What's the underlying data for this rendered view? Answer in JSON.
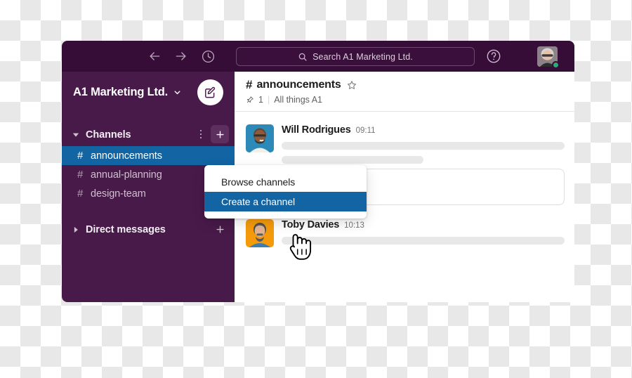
{
  "window": {
    "app": "Slack"
  },
  "topbar": {
    "back_icon": "arrow-left-icon",
    "forward_icon": "arrow-right-icon",
    "history_icon": "clock-icon",
    "search_icon": "search-icon",
    "search_placeholder": "Search A1 Marketing Ltd.",
    "search_value": "",
    "help_icon": "question-circle-icon",
    "avatar_name": "user-avatar",
    "presence": "online",
    "bg_color": "#350d36"
  },
  "sidebar": {
    "workspace_name": "A1 Marketing Ltd.",
    "workspace_caret_icon": "chevron-down-icon",
    "compose_icon": "compose-pencil-icon",
    "bg_color": "#481a49",
    "active_color": "#1264a3",
    "sections": [
      {
        "title": "Channels",
        "caret_icon": "caret-down-icon",
        "kebab_icon": "kebab-vertical-icon",
        "plus_icon": "plus-icon",
        "expanded": true,
        "channels": [
          {
            "hash": "#",
            "name": "announcements",
            "active": true
          },
          {
            "hash": "#",
            "name": "annual-planning",
            "active": false
          },
          {
            "hash": "#",
            "name": "design-team",
            "active": false
          }
        ]
      },
      {
        "title": "Direct messages",
        "caret_icon": "caret-right-icon",
        "plus_icon": "plus-icon",
        "expanded": false,
        "channels": []
      }
    ]
  },
  "channel_header": {
    "hash": "#",
    "name": "announcements",
    "star_icon": "star-outline-icon",
    "pin_icon": "pin-icon",
    "pin_count": "1",
    "divider": "|",
    "topic": "All things A1"
  },
  "messages": [
    {
      "author": "Will Rodrigues",
      "time": "09:11",
      "avatar_name": "avatar-will-rodrigues",
      "avatar_bg": "#2b8ab8"
    },
    {
      "author": "Toby Davies",
      "time": "10:13",
      "avatar_name": "avatar-toby-davies",
      "avatar_bg": "#f59b0b"
    }
  ],
  "dropdown": {
    "items": [
      {
        "label": "Browse channels",
        "selected": false
      },
      {
        "label": "Create a channel",
        "selected": true
      }
    ],
    "highlight_color": "#1264a3"
  },
  "cursor": {
    "icon": "pointing-hand-cursor"
  }
}
